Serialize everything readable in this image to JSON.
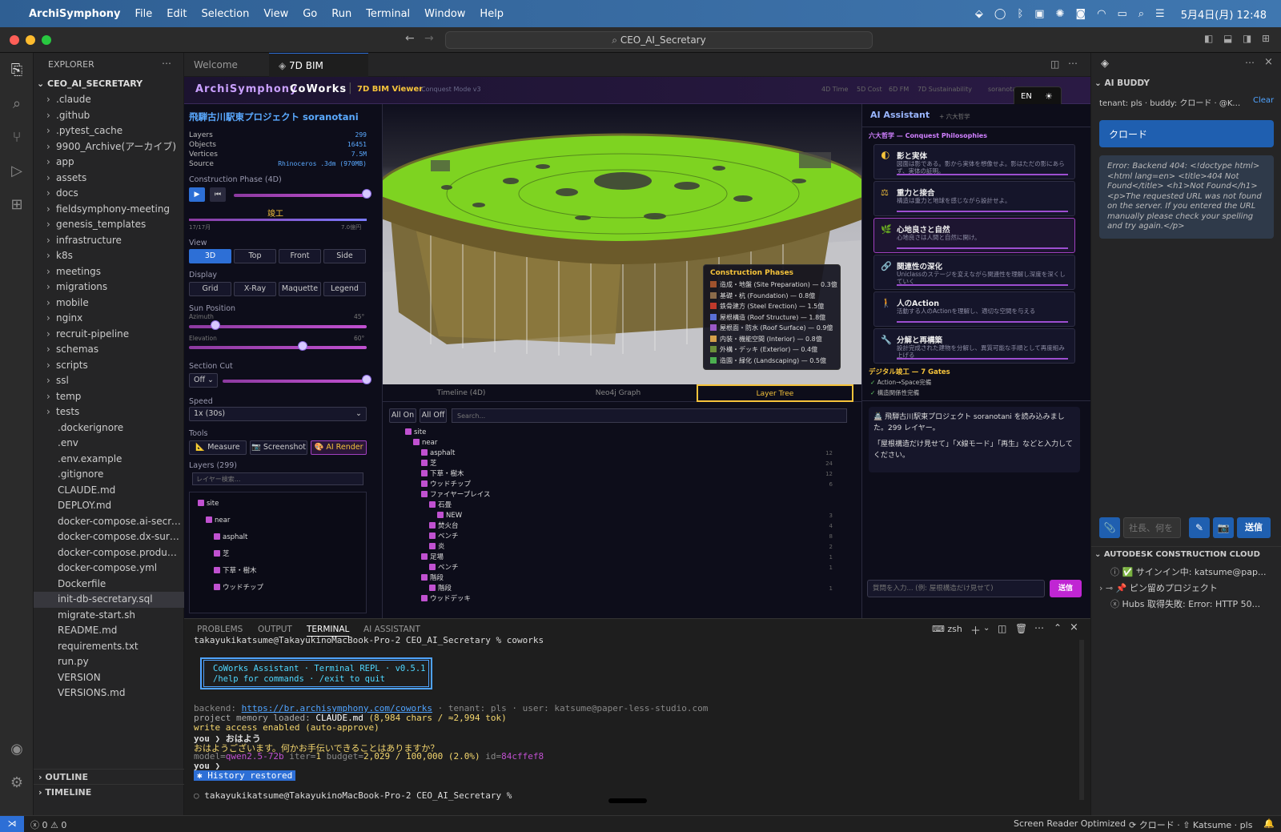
{
  "menubar": {
    "apple": "",
    "app": "ArchiSymphony",
    "items": [
      "File",
      "Edit",
      "Selection",
      "View",
      "Go",
      "Run",
      "Terminal",
      "Window",
      "Help"
    ],
    "clock": "5月4日(月) 12:48"
  },
  "titlebar": {
    "command_center": "CEO_AI_Secretary"
  },
  "explorer": {
    "title": "EXPLORER",
    "root": "CEO_AI_SECRETARY",
    "folders": [
      ".claude",
      ".github",
      ".pytest_cache",
      "9900_Archive(アーカイブ)",
      "app",
      "assets",
      "docs",
      "fieldsymphony-meeting",
      "genesis_templates",
      "infrastructure",
      "k8s",
      "meetings",
      "migrations",
      "mobile",
      "nginx",
      "recruit-pipeline",
      "schemas",
      "scripts",
      "ssl",
      "temp",
      "tests"
    ],
    "files": [
      ".dockerignore",
      ".env",
      ".env.example",
      ".gitignore",
      "CLAUDE.md",
      "DEPLOY.md",
      "docker-compose.ai-secret...",
      "docker-compose.dx-surve...",
      "docker-compose.productio...",
      "docker-compose.yml",
      "Dockerfile",
      "init-db-secretary.sql",
      "migrate-start.sh",
      "README.md",
      "requirements.txt",
      "run.py",
      "VERSION",
      "VERSIONS.md"
    ],
    "selected": "init-db-secretary.sql",
    "outline": "OUTLINE",
    "timeline": "TIMELINE"
  },
  "tabs": {
    "welcome": "Welcome",
    "active": "7D BIM Viewer"
  },
  "bim": {
    "brand_a": "ArchiSymphony",
    "brand_b": "CoWorks",
    "badge": "7D BIM Viewer",
    "mode": "Conquest Mode v3",
    "nav": [
      "4D Time",
      "5D Cost",
      "6D FM",
      "7D Sustainability",
      "soranotani"
    ],
    "lang": "EN",
    "theme_icon": "☀",
    "project_title": "飛騨古川駅東プロジェクト soranotani",
    "stats": [
      {
        "k": "Layers",
        "v": "299"
      },
      {
        "k": "Objects",
        "v": "16451"
      },
      {
        "k": "Vertices",
        "v": "7.5M"
      },
      {
        "k": "Source",
        "v": "Rhinoceros .3dm (970MB)"
      }
    ],
    "phase_label": "Construction Phase (4D)",
    "phase_name": "竣工",
    "phase_progress": "17/17月",
    "phase_cost": "7.0億円",
    "phase_fraction": 1.0,
    "view_label": "View",
    "views": [
      "3D",
      "Top",
      "Front",
      "Side"
    ],
    "display_label": "Display",
    "displays": [
      "Grid",
      "X-Ray",
      "Maquette",
      "Legend"
    ],
    "sun_label": "Sun Position",
    "azimuth_label": "Azimuth",
    "azimuth": "45°",
    "azimuth_fraction": 0.15,
    "elevation_label": "Elevation",
    "elevation": "60°",
    "elevation_fraction": 0.64,
    "section_label": "Section Cut",
    "section_value": "Off",
    "section_fraction": 1.0,
    "speed_label": "Speed",
    "speed_value": "1x (30s)",
    "tools_label": "Tools",
    "tools": [
      "📐 Measure",
      "📷 Screenshot",
      "🎨 AI Render"
    ],
    "layers_label": "Layers (299)",
    "layer_search_placeholder": "レイヤー検索...",
    "left_layers": [
      "site",
      "near",
      "asphalt",
      "芝",
      "下草・樹木",
      "ウッドチップ"
    ],
    "phases_title": "Construction Phases",
    "phases": [
      {
        "label": "造成・地盤 (Site Preparation) — 0.3億",
        "color": "#a0522d"
      },
      {
        "label": "基礎・杭 (Foundation) — 0.8億",
        "color": "#8b6b4a"
      },
      {
        "label": "鉄骨建方 (Steel Erection) — 1.5億",
        "color": "#c0392b"
      },
      {
        "label": "屋根構造 (Roof Structure) — 1.8億",
        "color": "#5a6fd6"
      },
      {
        "label": "屋根面・防水 (Roof Surface) — 0.9億",
        "color": "#9a59c7"
      },
      {
        "label": "内装・機能空間 (Interior) — 0.8億",
        "color": "#d4a04a"
      },
      {
        "label": "外構・デッキ (Exterior) — 0.4億",
        "color": "#6b8e3a"
      },
      {
        "label": "造園・緑化 (Landscaping) — 0.5億",
        "color": "#4caf50"
      }
    ],
    "view_tabs": [
      "Timeline (4D)",
      "Neo4j Graph",
      "Layer Tree"
    ],
    "all_on": "All On",
    "all_off": "All Off",
    "tree_search": "Search...",
    "tree": [
      {
        "n": "site",
        "d": 1,
        "c": ""
      },
      {
        "n": "near",
        "d": 2,
        "c": ""
      },
      {
        "n": "asphalt",
        "d": 3,
        "c": "12"
      },
      {
        "n": "芝",
        "d": 3,
        "c": "24"
      },
      {
        "n": "下草・樹木",
        "d": 3,
        "c": "12"
      },
      {
        "n": "ウッドチップ",
        "d": 3,
        "c": "6"
      },
      {
        "n": "ファイヤープレイス",
        "d": 3,
        "c": ""
      },
      {
        "n": "石畳",
        "d": 4,
        "c": ""
      },
      {
        "n": "NEW",
        "d": 5,
        "c": "3"
      },
      {
        "n": "焚火台",
        "d": 4,
        "c": "4"
      },
      {
        "n": "ベンチ",
        "d": 4,
        "c": "8"
      },
      {
        "n": "炎",
        "d": 4,
        "c": "2"
      },
      {
        "n": "足場",
        "d": 3,
        "c": "1"
      },
      {
        "n": "ベンチ",
        "d": 4,
        "c": "1"
      },
      {
        "n": "階段",
        "d": 3,
        "c": ""
      },
      {
        "n": "階段",
        "d": 4,
        "c": "1"
      },
      {
        "n": "ウッドデッキ",
        "d": 3,
        "c": ""
      }
    ],
    "ai_title": "AI Assistant",
    "ai_sub": "+ 六大哲学",
    "philo_title": "六大哲学 — Conquest Philosophies",
    "philos": [
      {
        "t": "影と実体",
        "d": "図面は影である。影から実体を想像せよ。影はただの影にあらず、実体の証明。",
        "i": "🌓"
      },
      {
        "t": "重力と接合",
        "d": "構造は重力と地球を感じながら設計せよ。",
        "i": "⚖"
      },
      {
        "t": "心地良さと自然",
        "d": "心地良さは人間と自然に開け。",
        "i": "🌿"
      },
      {
        "t": "関連性の深化",
        "d": "Uniclassのステージを変えながら関連性を理解し深度を深くしていく",
        "i": "🔗"
      },
      {
        "t": "人のAction",
        "d": "活動する人のActionを理解し、適切な空間を与える",
        "i": "🚶"
      },
      {
        "t": "分解と再構築",
        "d": "設計完成された建物を分解し、異質可能な手順として再度組み上げる",
        "i": "🔧"
      }
    ],
    "gates_title": "デジタル竣工 — 7 Gates",
    "gates": [
      "Action→Space完備",
      "構造関係性完備"
    ],
    "msg1": "🏯 飛騨古川駅東プロジェクト soranotani を読み込みました。299 レイヤー。",
    "msg2": "「屋根構造だけ見せて」「X線モード」「再生」などと入力してください。",
    "chat_placeholder": "質問を入力... (例: 屋根構造だけ見せて)",
    "send": "送信"
  },
  "panel": {
    "tabs": [
      "PROBLEMS",
      "OUTPUT",
      "TERMINAL",
      "AI ASSISTANT"
    ],
    "shell": "zsh",
    "prompt1": "takayukikatsume@TakayukinoMacBook-Pro-2 CEO_AI_Secretary % coworks",
    "box1": "CoWorks Assistant · Terminal REPL · v0.5.1",
    "box2": "/help for commands · /exit to quit",
    "backend_label": "backend:",
    "backend_url": "https://br.archisymphony.com/coworks",
    "tenant": "  ·  tenant: pls  ·  user: katsume@paper-less-studio.com",
    "memory_pre": "project memory loaded: ",
    "memory_file": "CLAUDE.md",
    "memory_post": " (8,984 chars / ≈2,994 tok)",
    "write": "write access enabled (auto-approve)",
    "you1": "you ❯ おはよう",
    "reply": "おはようございます。何かお手伝いできることはありますか？",
    "model_k": "model=",
    "model_v": "qwen2.5-72b",
    "iter_k": "  iter=",
    "iter_v": "1",
    "budget_k": "  budget=",
    "budget_v": "2,029 / 100,000 (2.0%)",
    "id_k": "  id=",
    "id_v": "84cffef8",
    "you2": "you ❯",
    "history": "✱  History restored",
    "prompt2": "takayukikatsume@TakayukinoMacBook-Pro-2 CEO_AI_Secretary %"
  },
  "rside": {
    "title": "AI BUDDY",
    "tenant": "tenant: pls · buddy: クロード · @Katsume",
    "clear": "Clear",
    "buddy": "クロード",
    "error": "Error: Backend 404: <!doctype html> <html lang=en> <title>404 Not Found</title> <h1>Not Found</h1> <p>The requested URL was not found on the server. If you entered the URL manually please check your spelling and try again.</p>",
    "input_placeholder": "社長、何を",
    "send": "送信",
    "acc_title": "AUTODESK CONSTRUCTION CLOUD",
    "acc_items": [
      "✅ サインイン中: katsume@pap...",
      "📌 ピン留めプロジェクト",
      "Hubs 取得失敗: Error: HTTP 50..."
    ]
  },
  "status": {
    "errors": "0",
    "warnings": "0",
    "reader": "Screen Reader Optimized",
    "buddy": "⟳ クロード · ⇧ Katsume · pls"
  },
  "colors": {
    "accent": "#2d6fd6",
    "purple": "#c050d0",
    "gold": "#f5c33b",
    "terminal_link": "#4fa3ff"
  }
}
